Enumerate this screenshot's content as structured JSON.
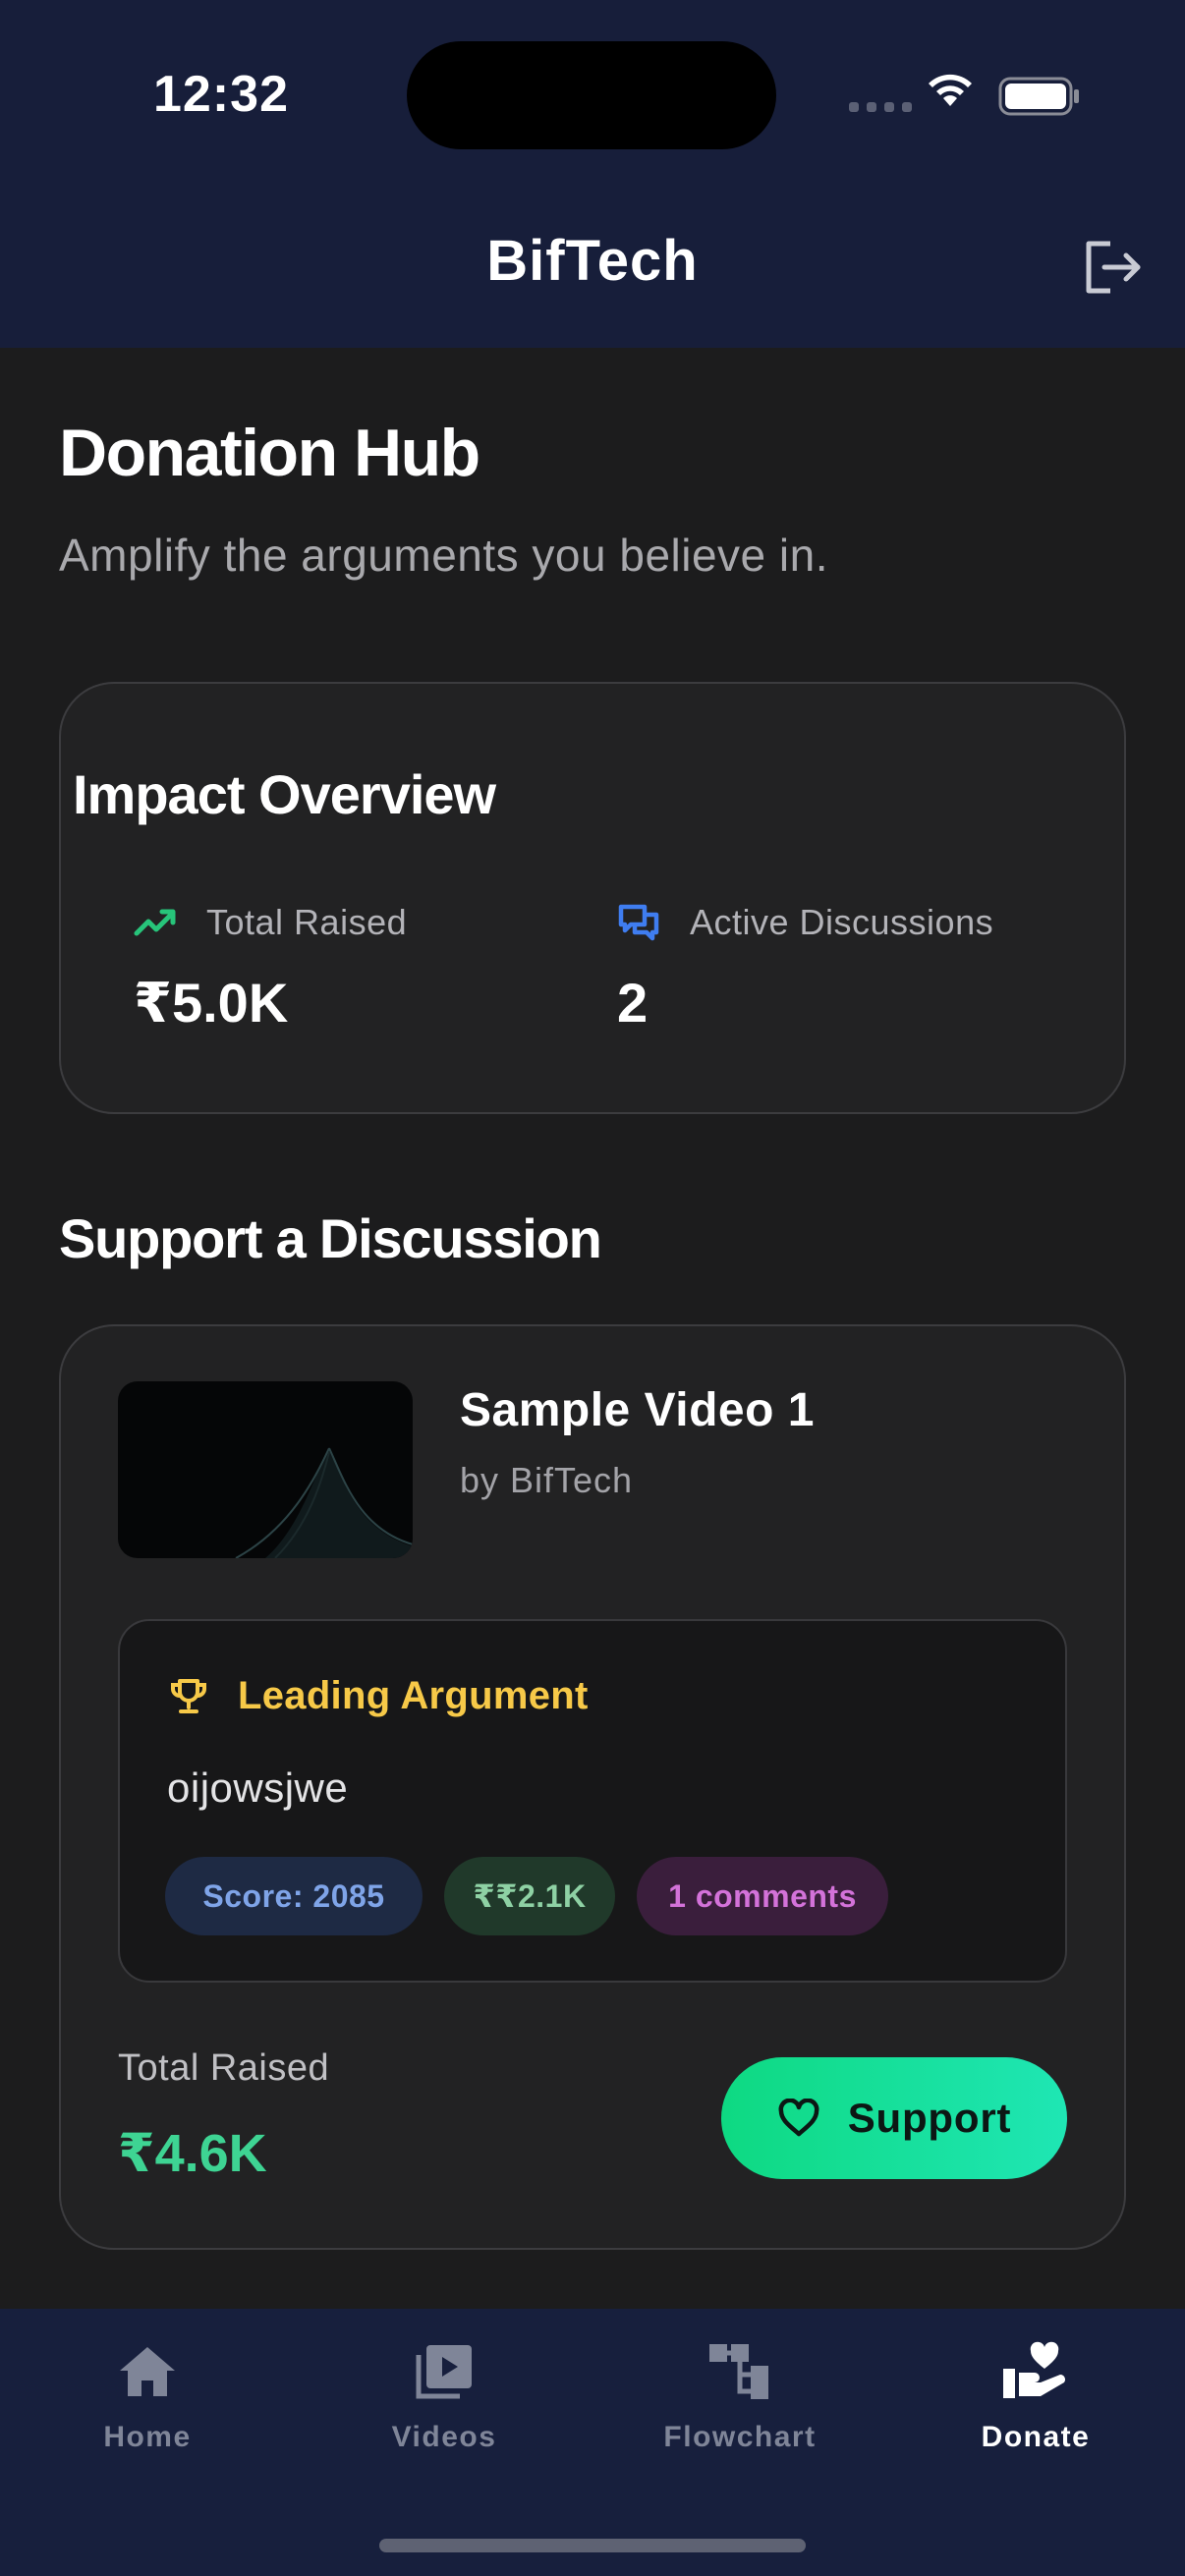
{
  "status_bar": {
    "time": "12:32"
  },
  "header": {
    "title": "BifTech",
    "logout_icon": "logout-icon"
  },
  "page": {
    "title": "Donation Hub",
    "subtitle": "Amplify the arguments you believe in."
  },
  "impact": {
    "title": "Impact Overview",
    "total_raised_label": "Total Raised",
    "total_raised_value": "₹5.0K",
    "active_discussions_label": "Active Discussions",
    "active_discussions_value": "2"
  },
  "support_section": {
    "title": "Support a Discussion",
    "discussion": {
      "video_title": "Sample Video 1",
      "author": "by BifTech",
      "leading_label": "Leading Argument",
      "argument_text": "oijowsjwe",
      "score_chip": "Score: 2085",
      "amount_chip": "₹₹2.1K",
      "comments_chip": "1 comments",
      "total_raised_label": "Total Raised",
      "total_raised_value": "₹4.6K",
      "support_label": "Support"
    }
  },
  "bottom_nav": {
    "items": [
      {
        "label": "Home",
        "icon": "home-icon"
      },
      {
        "label": "Videos",
        "icon": "video-library-icon"
      },
      {
        "label": "Flowchart",
        "icon": "flowchart-icon"
      },
      {
        "label": "Donate",
        "icon": "donate-hand-heart-icon",
        "active": true
      }
    ]
  },
  "colors": {
    "header_bg": "#171e3a",
    "page_bg": "#1c1c1d",
    "accent_green": "#3ed493",
    "accent_gold": "#f7c948",
    "accent_blue": "#3f7df0"
  }
}
